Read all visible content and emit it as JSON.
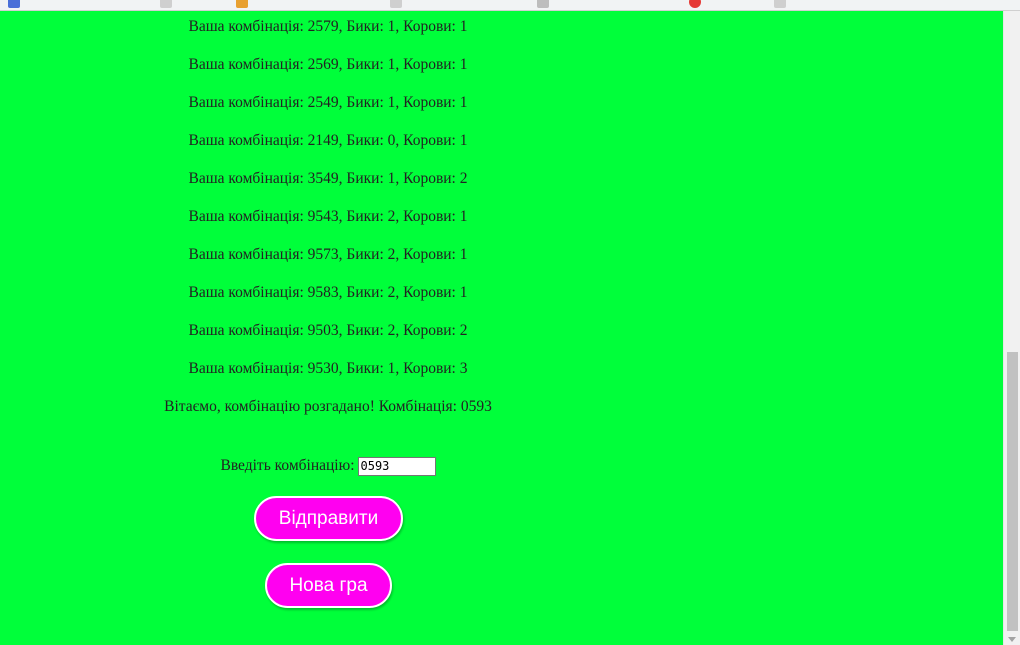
{
  "guesses": [
    "Ваша комбінація: 2579, Бики: 1, Корови: 1",
    "Ваша комбінація: 2569, Бики: 1, Корови: 1",
    "Ваша комбінація: 2549, Бики: 1, Корови: 1",
    "Ваша комбінація: 2149, Бики: 0, Корови: 1",
    "Ваша комбінація: 3549, Бики: 1, Корови: 2",
    "Ваша комбінація: 9543, Бики: 2, Корови: 1",
    "Ваша комбінація: 9573, Бики: 2, Корови: 1",
    "Ваша комбінація: 9583, Бики: 2, Корови: 1",
    "Ваша комбінація: 9503, Бики: 2, Корови: 2",
    "Ваша комбінація: 9530, Бики: 1, Корови: 3"
  ],
  "result_message": "Вітаємо, комбінацію розгадано! Комбінація: 0593",
  "input_label": "Введіть комбінацію:",
  "input_value": "0593",
  "submit_label": "Відправити",
  "new_game_label": "Нова гра",
  "colors": {
    "page_background": "#00ff3a",
    "button_background": "#ff00f0",
    "button_text": "#ffffff"
  }
}
